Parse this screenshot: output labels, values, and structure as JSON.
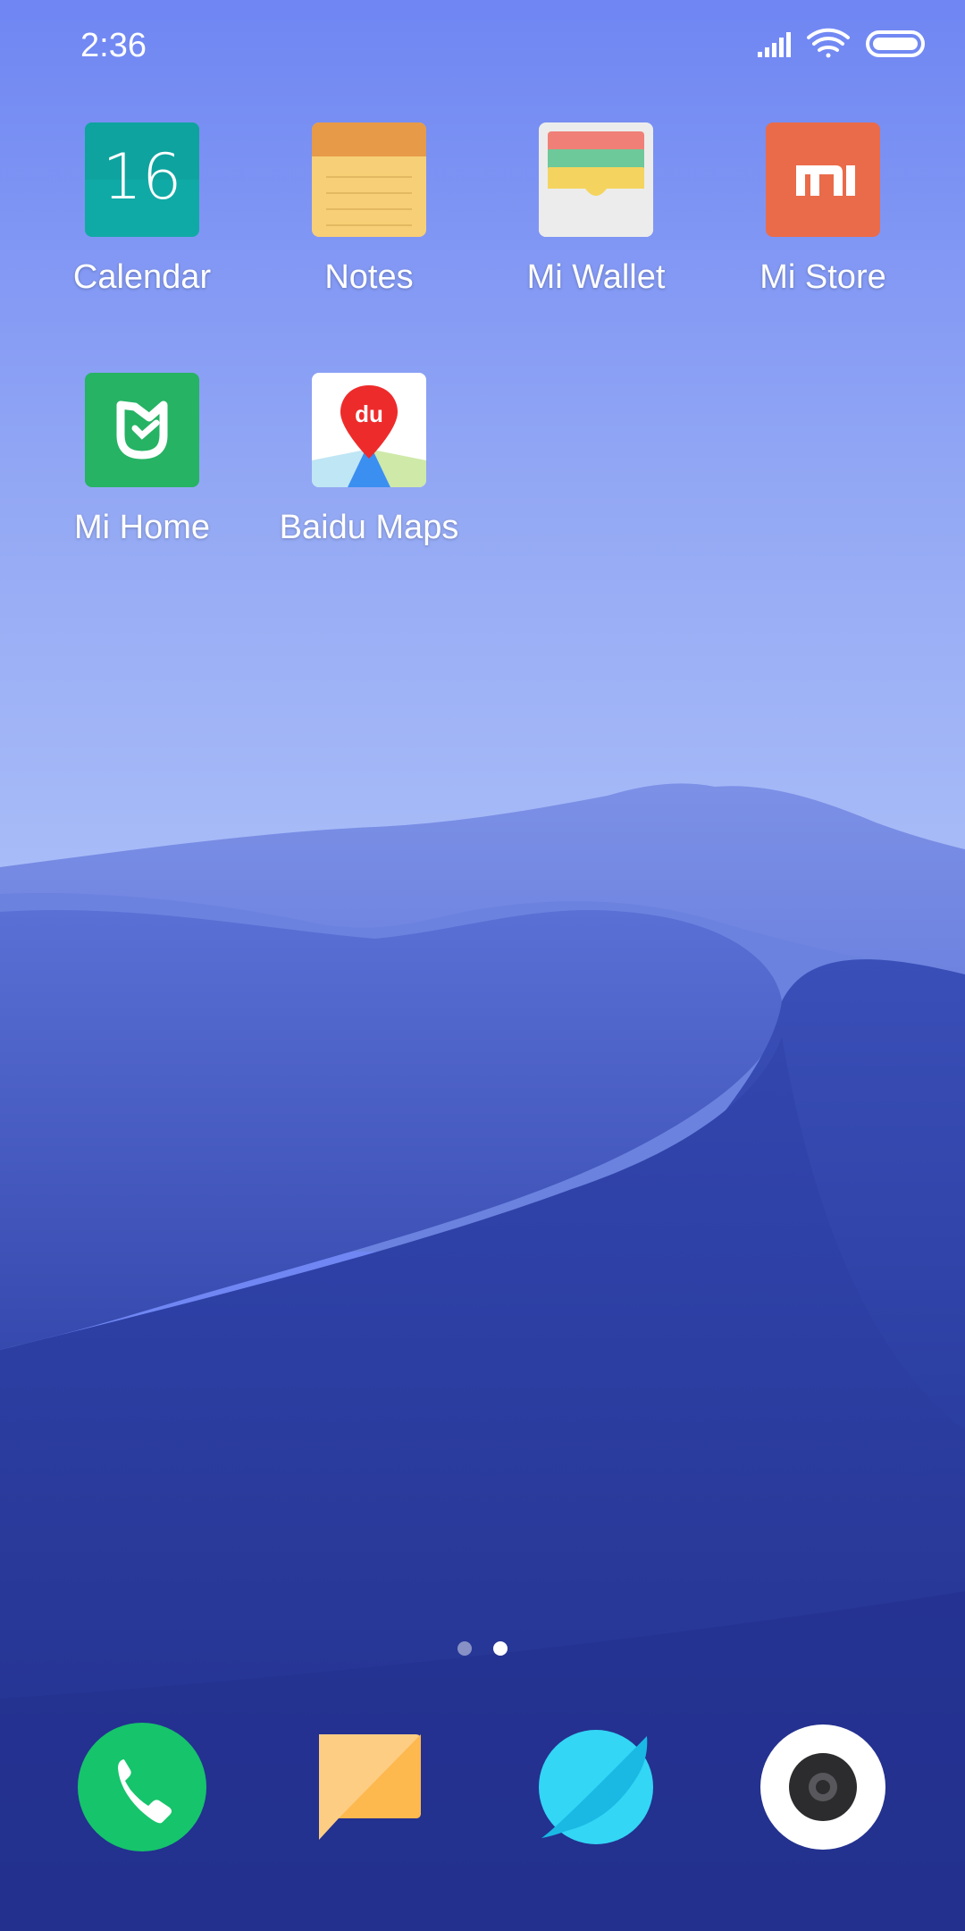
{
  "status_bar": {
    "time": "2:36",
    "icons": [
      "signal-icon",
      "wifi-icon",
      "battery-icon"
    ]
  },
  "home_apps": [
    {
      "label": "Calendar",
      "icon": "calendar-icon",
      "calendar_day": "16",
      "color": "#10aaa6"
    },
    {
      "label": "Notes",
      "icon": "notes-icon",
      "color": "#f7cf76"
    },
    {
      "label": "Mi Wallet",
      "icon": "wallet-icon",
      "color": "#ececec"
    },
    {
      "label": "Mi Store",
      "icon": "mi-store-icon",
      "color": "#ea6b4a"
    },
    {
      "label": "Mi Home",
      "icon": "mi-home-icon",
      "color": "#26b364"
    },
    {
      "label": "Baidu Maps",
      "icon": "baidu-maps-icon",
      "icon_text": "du",
      "color": "#ffffff"
    }
  ],
  "pager": {
    "pages": 2,
    "current": 2
  },
  "dock": [
    {
      "icon": "phone-icon",
      "color": "#16c46b"
    },
    {
      "icon": "messages-icon",
      "color": "#fdb84e"
    },
    {
      "icon": "browser-icon",
      "color": "#22c4ee"
    },
    {
      "icon": "camera-icon",
      "color": "#ffffff"
    }
  ]
}
